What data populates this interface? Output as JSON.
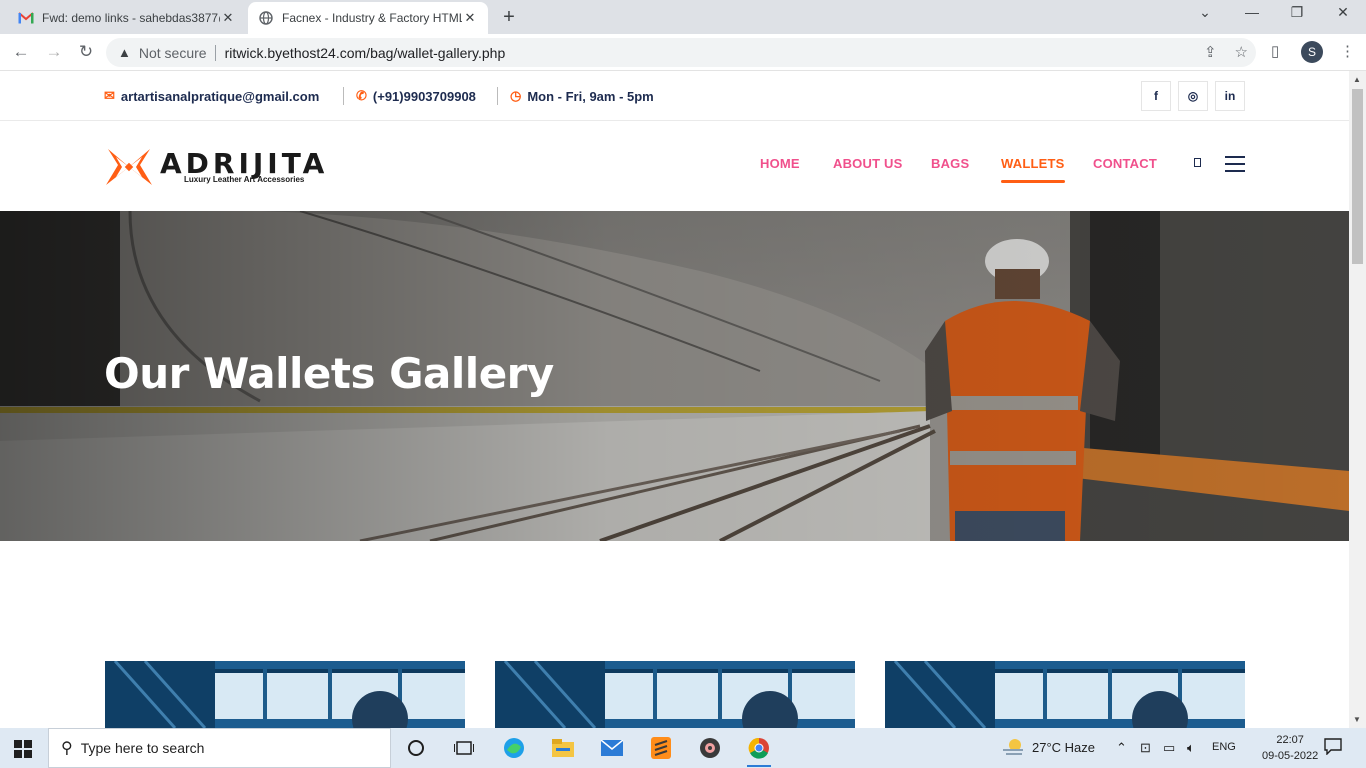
{
  "browser": {
    "tabs": [
      {
        "title": "Fwd: demo links - sahebdas3877@",
        "active": false,
        "favicon": "gmail-icon"
      },
      {
        "title": "Facnex - Industry & Factory HTML",
        "active": true,
        "favicon": "globe-icon"
      }
    ],
    "security_label": "Not secure",
    "url": "ritwick.byethost24.com/bag/wallet-gallery.php",
    "profile_initial": "S"
  },
  "topbar": {
    "email": "artartisanalpratique@gmail.com",
    "phone": "(+91)9903709908",
    "hours": "Mon - Fri, 9am - 5pm",
    "social": [
      {
        "label": "f",
        "name": "facebook-icon"
      },
      {
        "label": "◎",
        "name": "instagram-icon"
      },
      {
        "label": "in",
        "name": "linkedin-icon"
      }
    ]
  },
  "header": {
    "brand": "ADRIJITA",
    "tagline": "Luxury Leather Art Accessories",
    "menu": [
      {
        "label": "HOME",
        "active": false
      },
      {
        "label": "ABOUT US",
        "active": false
      },
      {
        "label": "BAGS",
        "active": false
      },
      {
        "label": "WALLETS",
        "active": true
      },
      {
        "label": "CONTACT",
        "active": false
      }
    ]
  },
  "hero": {
    "title": "Our Wallets Gallery"
  },
  "colors": {
    "accent": "#ff5e14",
    "menu_pink": "#f0508c",
    "navy": "#1d2b4f"
  },
  "taskbar": {
    "search_placeholder": "Type here to search",
    "weather": "27°C  Haze",
    "language": "ENG",
    "time": "22:07",
    "date": "09-05-2022"
  }
}
